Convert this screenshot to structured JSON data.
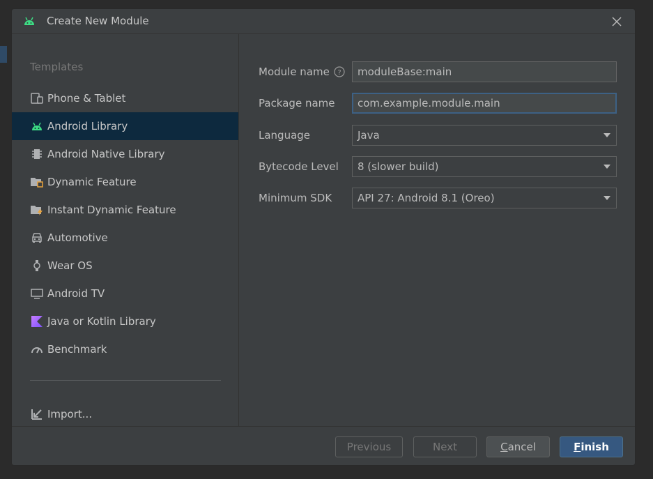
{
  "dialog": {
    "title": "Create New Module",
    "close_icon": "close-icon"
  },
  "sidebar": {
    "heading": "Templates",
    "items": [
      {
        "label": "Phone & Tablet",
        "icon": "phone-tablet-icon"
      },
      {
        "label": "Android Library",
        "icon": "android-icon",
        "selected": true
      },
      {
        "label": "Android Native Library",
        "icon": "native-library-icon"
      },
      {
        "label": "Dynamic Feature",
        "icon": "dynamic-feature-icon"
      },
      {
        "label": "Instant Dynamic Feature",
        "icon": "instant-dynamic-feature-icon"
      },
      {
        "label": "Automotive",
        "icon": "car-icon"
      },
      {
        "label": "Wear OS",
        "icon": "watch-icon"
      },
      {
        "label": "Android TV",
        "icon": "tv-icon"
      },
      {
        "label": "Java or Kotlin Library",
        "icon": "kotlin-icon"
      },
      {
        "label": "Benchmark",
        "icon": "gauge-icon"
      }
    ],
    "import_label": "Import..."
  },
  "form": {
    "module_name": {
      "label": "Module name",
      "value": "moduleBase:main"
    },
    "package_name": {
      "label": "Package name",
      "value": "com.example.module.main"
    },
    "language": {
      "label": "Language",
      "value": "Java"
    },
    "bytecode_level": {
      "label": "Bytecode Level",
      "value": "8 (slower build)"
    },
    "minimum_sdk": {
      "label": "Minimum SDK",
      "value": "API 27: Android 8.1 (Oreo)"
    }
  },
  "footer": {
    "previous": "Previous",
    "next": "Next",
    "cancel_mnemonic": "C",
    "cancel_rest": "ancel",
    "finish_mnemonic": "F",
    "finish_rest": "inish"
  },
  "colors": {
    "dialog_bg": "#3c3f41",
    "selection": "#0d293e",
    "android_green": "#3ddc84",
    "primary_button": "#365880",
    "focus_border": "#3d6185"
  }
}
